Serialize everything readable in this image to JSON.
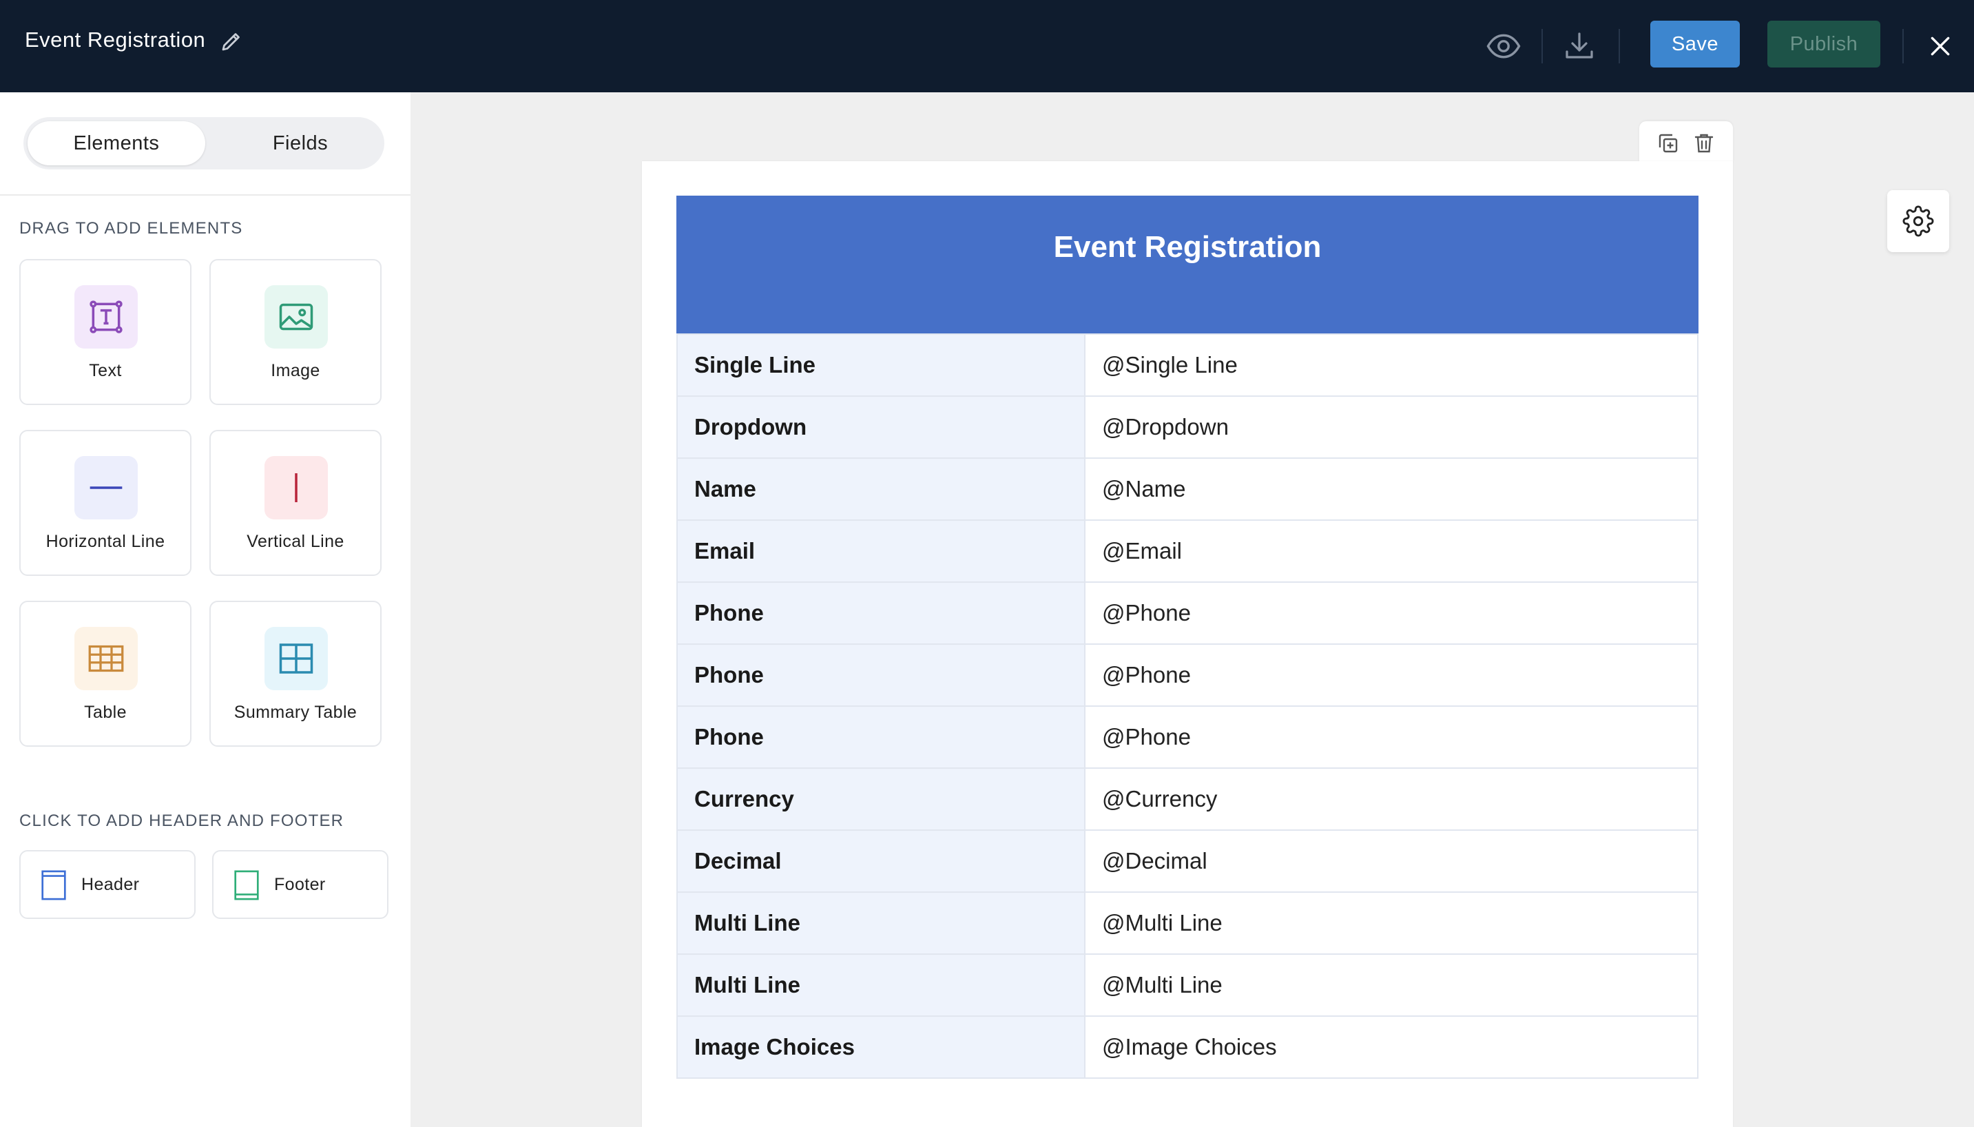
{
  "app": {
    "title": "Event Registration",
    "save_label": "Save",
    "publish_label": "Publish"
  },
  "sidebar": {
    "tabs": [
      "Elements",
      "Fields"
    ],
    "elements_section_title": "DRAG TO ADD ELEMENTS",
    "elements": [
      {
        "label": "Text",
        "icon": "text-icon"
      },
      {
        "label": "Image",
        "icon": "image-icon"
      },
      {
        "label": "Horizontal Line",
        "icon": "horizontal-line-icon"
      },
      {
        "label": "Vertical Line",
        "icon": "vertical-line-icon"
      },
      {
        "label": "Table",
        "icon": "table-icon"
      },
      {
        "label": "Summary Table",
        "icon": "summary-table-icon"
      }
    ],
    "header_footer_section_title": "CLICK TO ADD HEADER AND FOOTER",
    "header_label": "Header",
    "footer_label": "Footer"
  },
  "form": {
    "title": "Event Registration",
    "rows": [
      {
        "label": "Single Line",
        "value": "@Single Line"
      },
      {
        "label": "Dropdown",
        "value": "@Dropdown"
      },
      {
        "label": "Name",
        "value": "@Name"
      },
      {
        "label": "Email",
        "value": "@Email"
      },
      {
        "label": "Phone",
        "value": "@Phone"
      },
      {
        "label": "Phone",
        "value": "@Phone"
      },
      {
        "label": "Phone",
        "value": "@Phone"
      },
      {
        "label": "Currency",
        "value": "@Currency"
      },
      {
        "label": "Decimal",
        "value": "@Decimal"
      },
      {
        "label": "Multi Line",
        "value": "@Multi Line"
      },
      {
        "label": "Multi Line",
        "value": "@Multi Line"
      },
      {
        "label": "Image Choices",
        "value": "@Image Choices"
      }
    ]
  },
  "colors": {
    "topbar": "#0f1c2e",
    "save": "#3d86cf",
    "publish": "#1d5348",
    "form_header": "#4670c8",
    "label_cell": "#eef3fc"
  }
}
